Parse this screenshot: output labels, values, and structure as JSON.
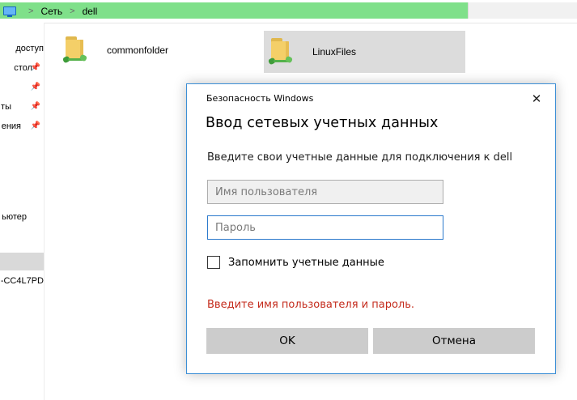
{
  "address": {
    "crumbs": [
      "Сеть",
      "dell"
    ],
    "separator": ">",
    "computer_icon": "computer-icon",
    "load_progress": 0.81
  },
  "sidebar": {
    "items": [
      {
        "label": "доступ",
        "pinned": true
      },
      {
        "label": "стол",
        "pinned": true
      },
      {
        "label": "",
        "pinned": true
      },
      {
        "label": "ты",
        "pinned": true
      },
      {
        "label": "ения",
        "pinned": true
      },
      {
        "label": "ьютер",
        "pinned": false
      },
      {
        "label": "",
        "pinned": false,
        "selected": true
      },
      {
        "label": "-CC4L7PD",
        "pinned": false
      }
    ],
    "pin_glyph": "📌"
  },
  "files": [
    {
      "name": "commonfolder",
      "icon": "network-share-folder-icon",
      "selected": false
    },
    {
      "name": "LinuxFiles",
      "icon": "network-share-folder-icon",
      "selected": true
    }
  ],
  "dialog": {
    "window_title": "Безопасность Windows",
    "close_glyph": "✕",
    "heading": "Ввод сетевых учетных данных",
    "message": "Введите свои учетные данные для подключения к dell",
    "username": {
      "value": "",
      "placeholder": "Имя пользователя"
    },
    "password": {
      "value": "",
      "placeholder": "Пароль"
    },
    "remember_label": "Запомнить учетные данные",
    "remember_checked": false,
    "error": "Введите имя пользователя и пароль.",
    "ok_label": "OK",
    "cancel_label": "Отмена",
    "error_color": "#c42b1c",
    "accent_color": "#3c8fd6"
  }
}
